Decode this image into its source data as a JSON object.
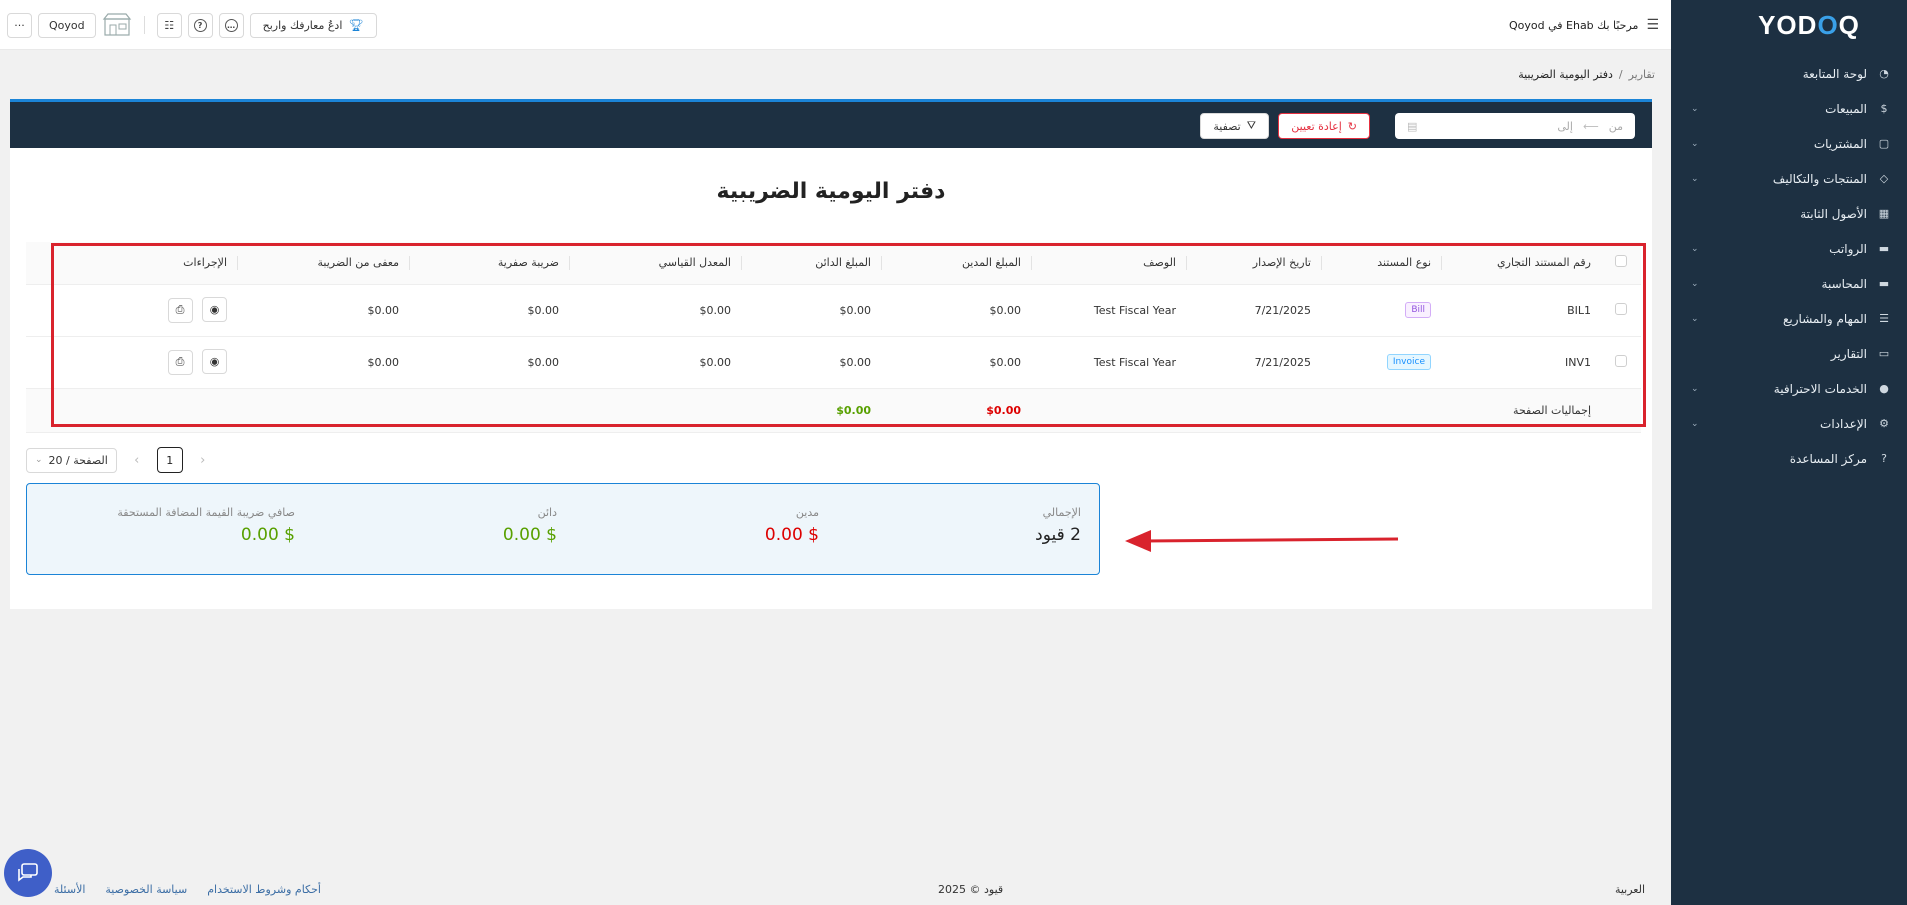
{
  "sidebar": {
    "logo": "QOYOD",
    "items": [
      {
        "label": "لوحة المتابعة",
        "icon": "dashboard-icon",
        "expandable": false
      },
      {
        "label": "المبيعات",
        "icon": "dollar-icon",
        "expandable": true
      },
      {
        "label": "المشتريات",
        "icon": "clipboard-icon",
        "expandable": true
      },
      {
        "label": "المنتجات والتكاليف",
        "icon": "box-icon",
        "expandable": true
      },
      {
        "label": "الأصول الثابتة",
        "icon": "grid-icon",
        "expandable": false
      },
      {
        "label": "الرواتب",
        "icon": "folder-icon",
        "expandable": true
      },
      {
        "label": "المحاسبة",
        "icon": "folder-icon",
        "expandable": true
      },
      {
        "label": "المهام والمشاريع",
        "icon": "list-icon",
        "expandable": true
      },
      {
        "label": "التقارير",
        "icon": "document-icon",
        "expandable": false
      },
      {
        "label": "الخدمات الاحترافية",
        "icon": "search-icon",
        "expandable": true
      },
      {
        "label": "الإعدادات",
        "icon": "gear-icon",
        "expandable": true
      },
      {
        "label": "مركز المساعدة",
        "icon": "help-icon",
        "expandable": false
      }
    ]
  },
  "header": {
    "welcome": "مرحبًا بك Ehab في Qoyod",
    "invite_label": "ادعُ معارفك واربح",
    "company_label": "Qoyod",
    "more_label": "···"
  },
  "breadcrumb": {
    "parent": "تقارير",
    "separator": "/",
    "current": "دفتر اليومية الضريبية"
  },
  "filters": {
    "from_placeholder": "من",
    "to_placeholder": "إلى",
    "reset_label": "إعادة تعيين",
    "filter_label": "تصفية"
  },
  "page_title": "دفتر اليومية الضريبية",
  "table": {
    "headers": {
      "doc_number": "رقم المستند التجاري",
      "doc_type": "نوع المستند",
      "issue_date": "تاريخ الإصدار",
      "description": "الوصف",
      "debit": "المبلغ المدين",
      "credit": "المبلغ الدائن",
      "standard_rate": "المعدل القياسي",
      "zero_tax": "ضريبة صفرية",
      "exempt": "معفى من الضريبة",
      "actions": "الإجراءات"
    },
    "rows": [
      {
        "doc_number": "BIL1",
        "doc_type": "Bill",
        "issue_date": "7/21/2025",
        "description": "Test Fiscal Year",
        "debit": "$0.00",
        "credit": "$0.00",
        "standard_rate": "$0.00",
        "zero_tax": "$0.00",
        "exempt": "$0.00"
      },
      {
        "doc_number": "INV1",
        "doc_type": "Invoice",
        "issue_date": "7/21/2025",
        "description": "Test Fiscal Year",
        "debit": "$0.00",
        "credit": "$0.00",
        "standard_rate": "$0.00",
        "zero_tax": "$0.00",
        "exempt": "$0.00"
      }
    ],
    "totals": {
      "label": "إجماليات الصفحة",
      "debit": "$0.00",
      "credit": "$0.00"
    }
  },
  "pagination": {
    "current_page": "1",
    "page_size_label": "20 / الصفحة"
  },
  "summary": {
    "total_label": "الإجمالي",
    "total_value": "2 قيود",
    "debit_label": "مدين",
    "debit_value": "$ 0.00",
    "credit_label": "دائن",
    "credit_value": "$ 0.00",
    "net_vat_label": "صافي ضريبة القيمة المضافة المستحقة",
    "net_vat_value": "$ 0.00"
  },
  "footer": {
    "language": "العربية",
    "copyright": "قيود © 2025",
    "terms": "أحكام وشروط الاستخدام",
    "privacy": "سياسة الخصوصية",
    "faq": "الأسئلة"
  },
  "colors": {
    "sidebar_bg": "#1d3042",
    "accent": "#1b84d7",
    "danger": "#e53040",
    "debit_red": "#d00000",
    "credit_green": "#58a000",
    "annotation_red": "#d9232d"
  }
}
